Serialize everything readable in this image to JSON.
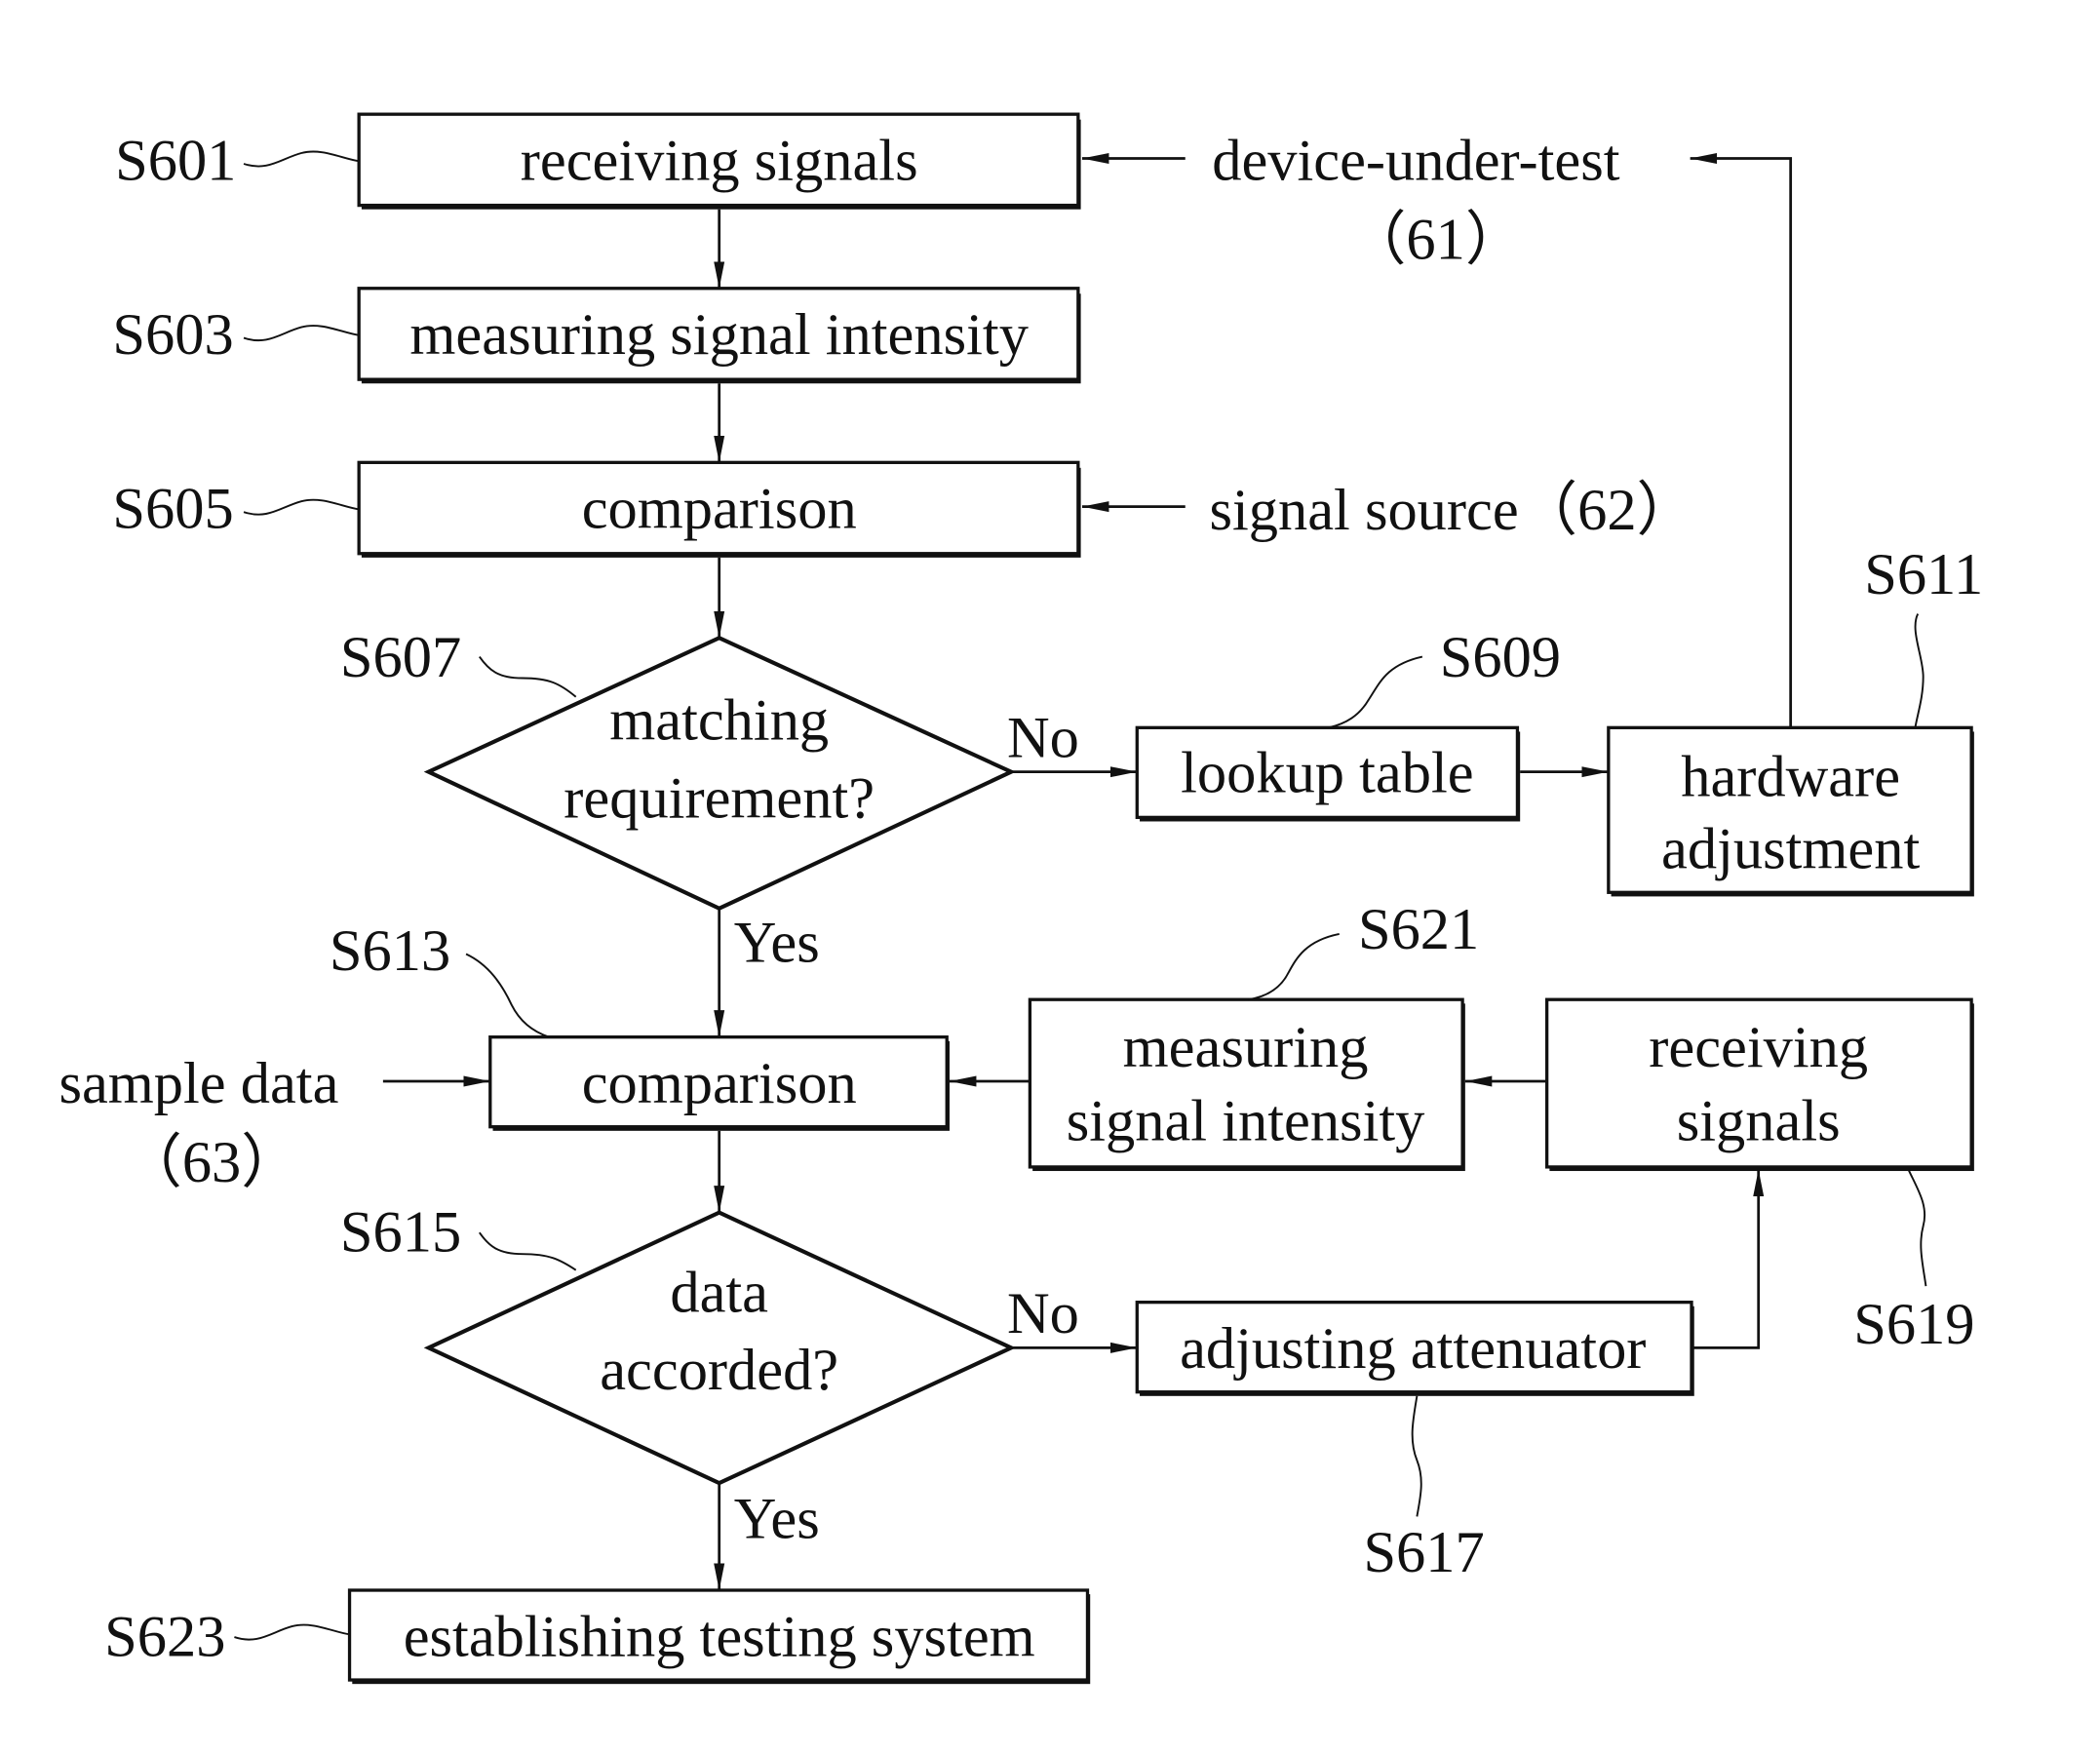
{
  "diagram": {
    "type": "flowchart",
    "colors": {
      "ink": "#111111",
      "background": "#ffffff"
    },
    "steps": {
      "s601": {
        "ref": "S601",
        "label": "receiving signals"
      },
      "s603": {
        "ref": "S603",
        "label": "measuring signal intensity"
      },
      "s605": {
        "ref": "S605",
        "label": "comparison"
      },
      "s607": {
        "ref": "S607",
        "label_line1": "matching",
        "label_line2": "requirement?"
      },
      "s609": {
        "ref": "S609",
        "label": "lookup table"
      },
      "s611": {
        "ref": "S611",
        "label_line1": "hardware",
        "label_line2": "adjustment"
      },
      "s613": {
        "ref": "S613",
        "label": "comparison"
      },
      "s615": {
        "ref": "S615",
        "label_line1": "data",
        "label_line2": "accorded?"
      },
      "s617": {
        "ref": "S617",
        "label": "adjusting attenuator"
      },
      "s619": {
        "ref": "S619",
        "label_line1": "receiving",
        "label_line2": "signals"
      },
      "s621": {
        "ref": "S621",
        "label_line1": "measuring",
        "label_line2": "signal intensity"
      },
      "s623": {
        "ref": "S623",
        "label": "establishing testing system"
      }
    },
    "inputs": {
      "dut": {
        "label": "device-under-test",
        "ref": "（61）"
      },
      "signal_source": {
        "label": "signal source（62）"
      },
      "sample_data": {
        "label": "sample data",
        "ref": "（63）"
      }
    },
    "branches": {
      "yes": "Yes",
      "no": "No"
    },
    "edges": [
      [
        "device-under-test",
        "S601"
      ],
      [
        "S601",
        "S603"
      ],
      [
        "S603",
        "S605"
      ],
      [
        "signal source",
        "S605"
      ],
      [
        "S605",
        "S607"
      ],
      [
        "S607",
        "S609",
        "No"
      ],
      [
        "S609",
        "S611"
      ],
      [
        "S611",
        "device-under-test"
      ],
      [
        "S607",
        "S613",
        "Yes"
      ],
      [
        "sample data",
        "S613"
      ],
      [
        "S621",
        "S613"
      ],
      [
        "S619",
        "S621"
      ],
      [
        "S613",
        "S615"
      ],
      [
        "S615",
        "S617",
        "No"
      ],
      [
        "S617",
        "S619"
      ],
      [
        "S615",
        "S623",
        "Yes"
      ]
    ]
  }
}
